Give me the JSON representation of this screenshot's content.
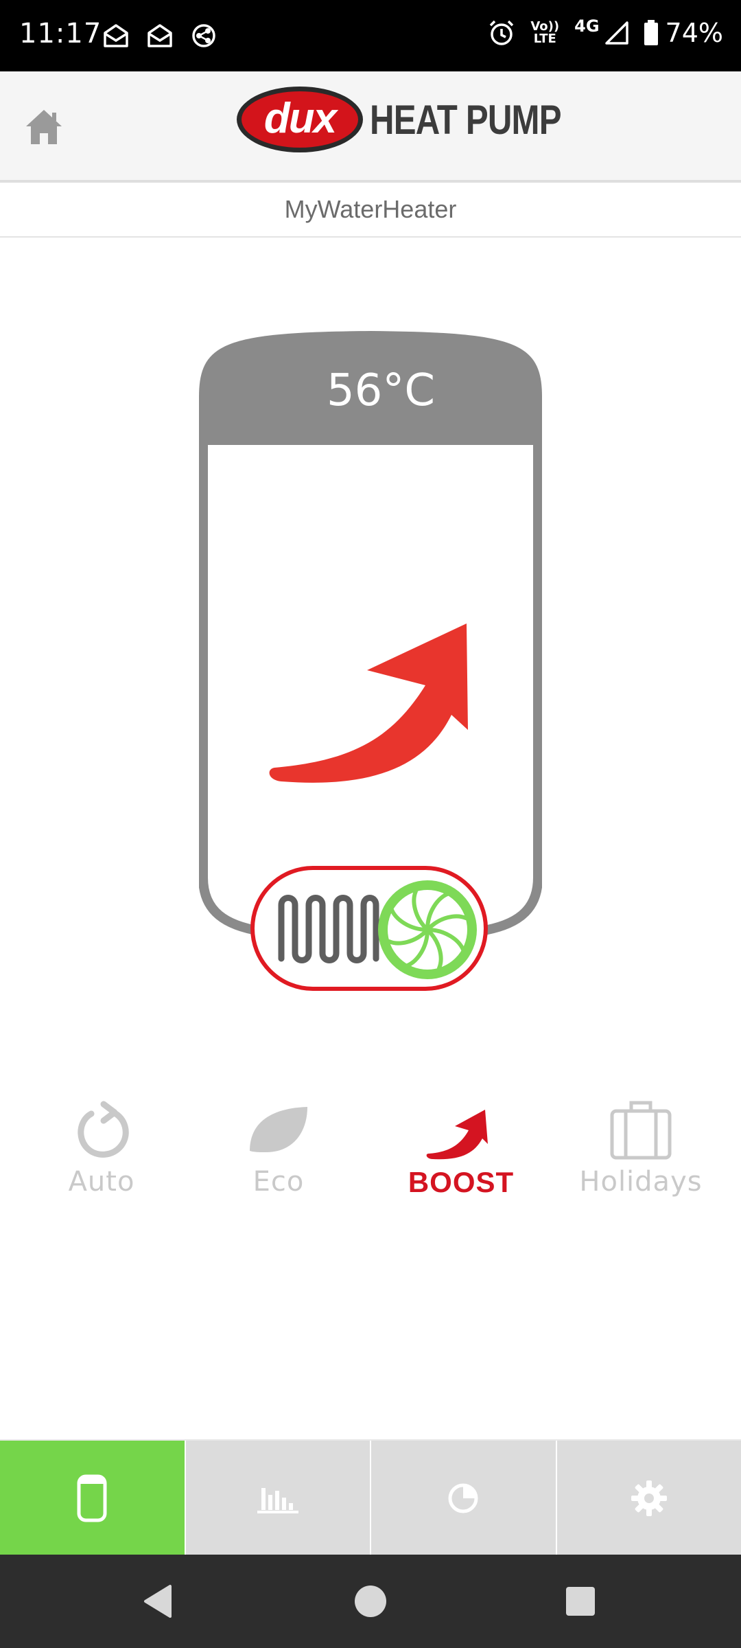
{
  "status_bar": {
    "time": "11:17",
    "network_top": "Vo))",
    "network_bottom": "LTE",
    "network_type": "4G",
    "battery": "74%"
  },
  "header": {
    "brand_logo": "dux",
    "brand_title": "HEAT PUMP",
    "home_icon": "home-icon"
  },
  "device": {
    "name": "MyWaterHeater"
  },
  "tank": {
    "temperature": "56°C",
    "active_mode_icon": "boost-arrow-icon",
    "heater_indicator": "element-icon",
    "heat_pump_indicator": "fan-icon"
  },
  "modes": [
    {
      "label": "Auto",
      "icon": "auto-refresh-icon",
      "active": false
    },
    {
      "label": "Eco",
      "icon": "leaf-icon",
      "active": false
    },
    {
      "label": "BOOST",
      "icon": "boost-arrow-icon",
      "active": true
    },
    {
      "label": "Holidays",
      "icon": "suitcase-icon",
      "active": false
    }
  ],
  "tabs": [
    {
      "icon": "tank-icon",
      "active": true
    },
    {
      "icon": "bar-chart-icon",
      "active": false
    },
    {
      "icon": "pie-chart-icon",
      "active": false
    },
    {
      "icon": "gear-icon",
      "active": false
    }
  ],
  "colors": {
    "accent_green": "#75d54a",
    "boost_red": "#e8352d",
    "brand_red": "#d3141b",
    "tank_grey": "#8a8a8a",
    "inactive_grey": "#c9c9c9"
  }
}
